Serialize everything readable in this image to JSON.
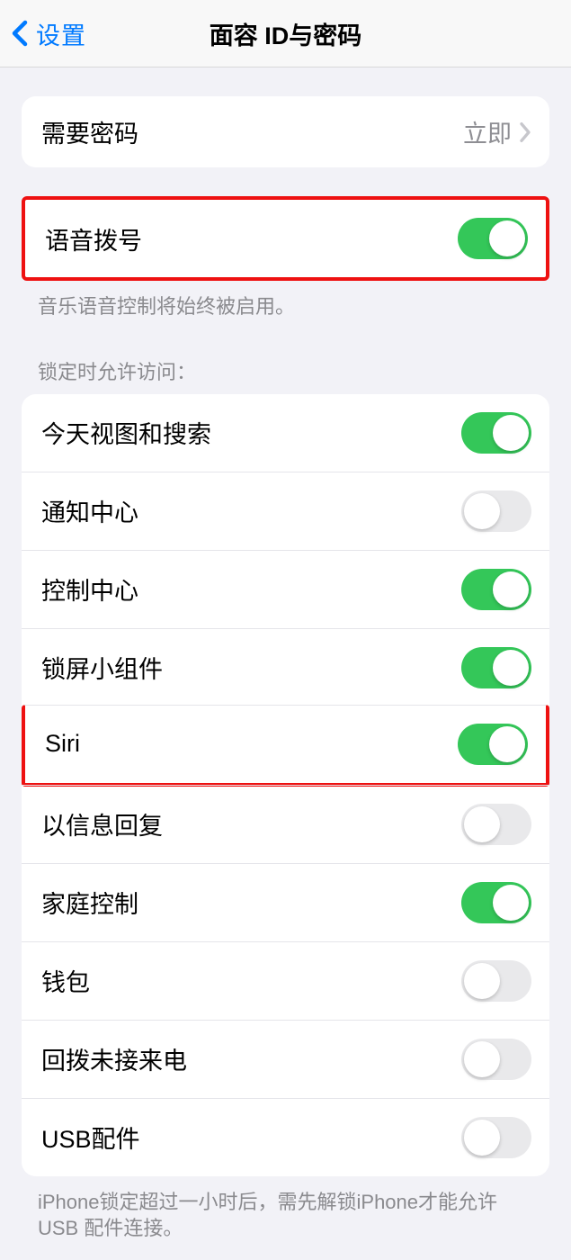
{
  "nav": {
    "back_label": "设置",
    "title": "面容 ID与密码"
  },
  "require_passcode": {
    "label": "需要密码",
    "value": "立即"
  },
  "voice_dial": {
    "label": "语音拨号",
    "enabled": true,
    "footer": "音乐语音控制将始终被启用。"
  },
  "locked_access": {
    "header": "锁定时允许访问：",
    "items": [
      {
        "label": "今天视图和搜索",
        "enabled": true
      },
      {
        "label": "通知中心",
        "enabled": false
      },
      {
        "label": "控制中心",
        "enabled": true
      },
      {
        "label": "锁屏小组件",
        "enabled": true
      },
      {
        "label": "Siri",
        "enabled": true,
        "highlighted": true
      },
      {
        "label": "以信息回复",
        "enabled": false
      },
      {
        "label": "家庭控制",
        "enabled": true
      },
      {
        "label": "钱包",
        "enabled": false
      },
      {
        "label": "回拨未接来电",
        "enabled": false
      },
      {
        "label": "USB配件",
        "enabled": false
      }
    ],
    "footer": "iPhone锁定超过一小时后，需先解锁iPhone才能允许USB 配件连接。"
  }
}
